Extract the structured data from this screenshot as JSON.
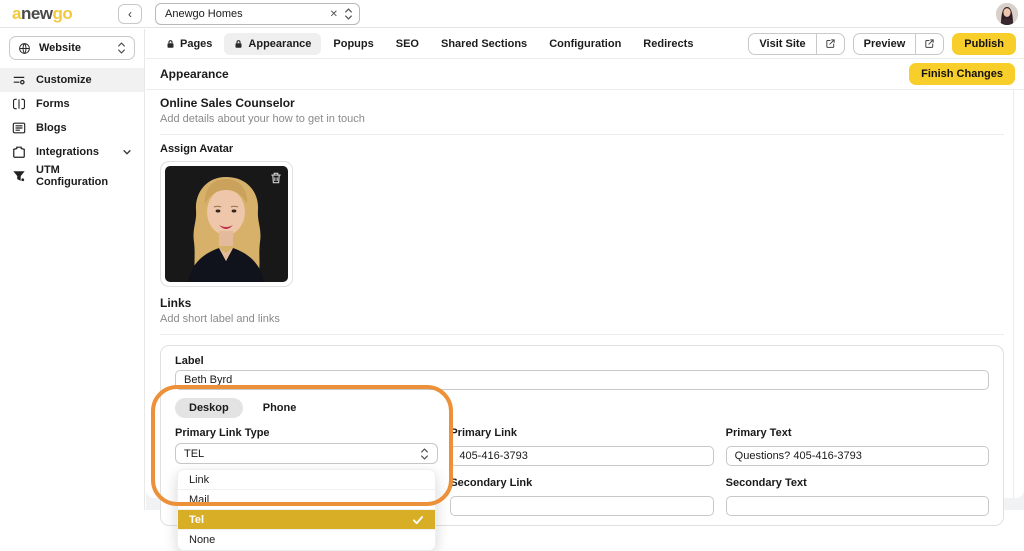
{
  "colors": {
    "accent_yellow": "#F8CE2A",
    "selected_option_gold": "#D9AE27",
    "annotation_orange": "#EC9139"
  },
  "topbar": {
    "logo_part_a": "a",
    "logo_part_new": "new",
    "logo_part_go": "go",
    "back_label": "‹",
    "site_selector_value": "Anewgo Homes",
    "clear_icon": "✕"
  },
  "sidebar": {
    "website_selector_label": "Website",
    "items": [
      {
        "label": "Customize"
      },
      {
        "label": "Forms"
      },
      {
        "label": "Blogs"
      },
      {
        "label": "Integrations"
      },
      {
        "label": "UTM Configuration"
      }
    ]
  },
  "tabbar": {
    "tabs": [
      {
        "label": "Pages"
      },
      {
        "label": "Appearance"
      },
      {
        "label": "Popups"
      },
      {
        "label": "SEO"
      },
      {
        "label": "Shared Sections"
      },
      {
        "label": "Configuration"
      },
      {
        "label": "Redirects"
      }
    ],
    "visit_site_label": "Visit Site",
    "preview_label": "Preview",
    "publish_label": "Publish"
  },
  "content": {
    "page_title": "Appearance",
    "finish_changes_label": "Finish Changes",
    "osc": {
      "title": "Online Sales Counselor",
      "subtitle": "Add details about your how to get in touch"
    },
    "avatar": {
      "label": "Assign Avatar"
    },
    "links": {
      "title": "Links",
      "subtitle": "Add short label and links",
      "label_field_label": "Label",
      "label_field_value": "Beth Byrd",
      "device_tabs": [
        {
          "label": "Deskop"
        },
        {
          "label": "Phone"
        }
      ],
      "primary_link_type": {
        "label": "Primary Link Type",
        "value": "TEL",
        "options": [
          {
            "label": "Link",
            "selected": false
          },
          {
            "label": "Mail",
            "selected": false
          },
          {
            "label": "Tel",
            "selected": true
          },
          {
            "label": "None",
            "selected": false
          }
        ]
      },
      "primary_link": {
        "label": "Primary Link",
        "value": "405-416-3793"
      },
      "primary_text": {
        "label": "Primary Text",
        "value": "Questions? 405-416-3793"
      },
      "secondary_link": {
        "label": "Secondary Link",
        "value": ""
      },
      "secondary_text": {
        "label": "Secondary Text",
        "value": ""
      }
    }
  }
}
